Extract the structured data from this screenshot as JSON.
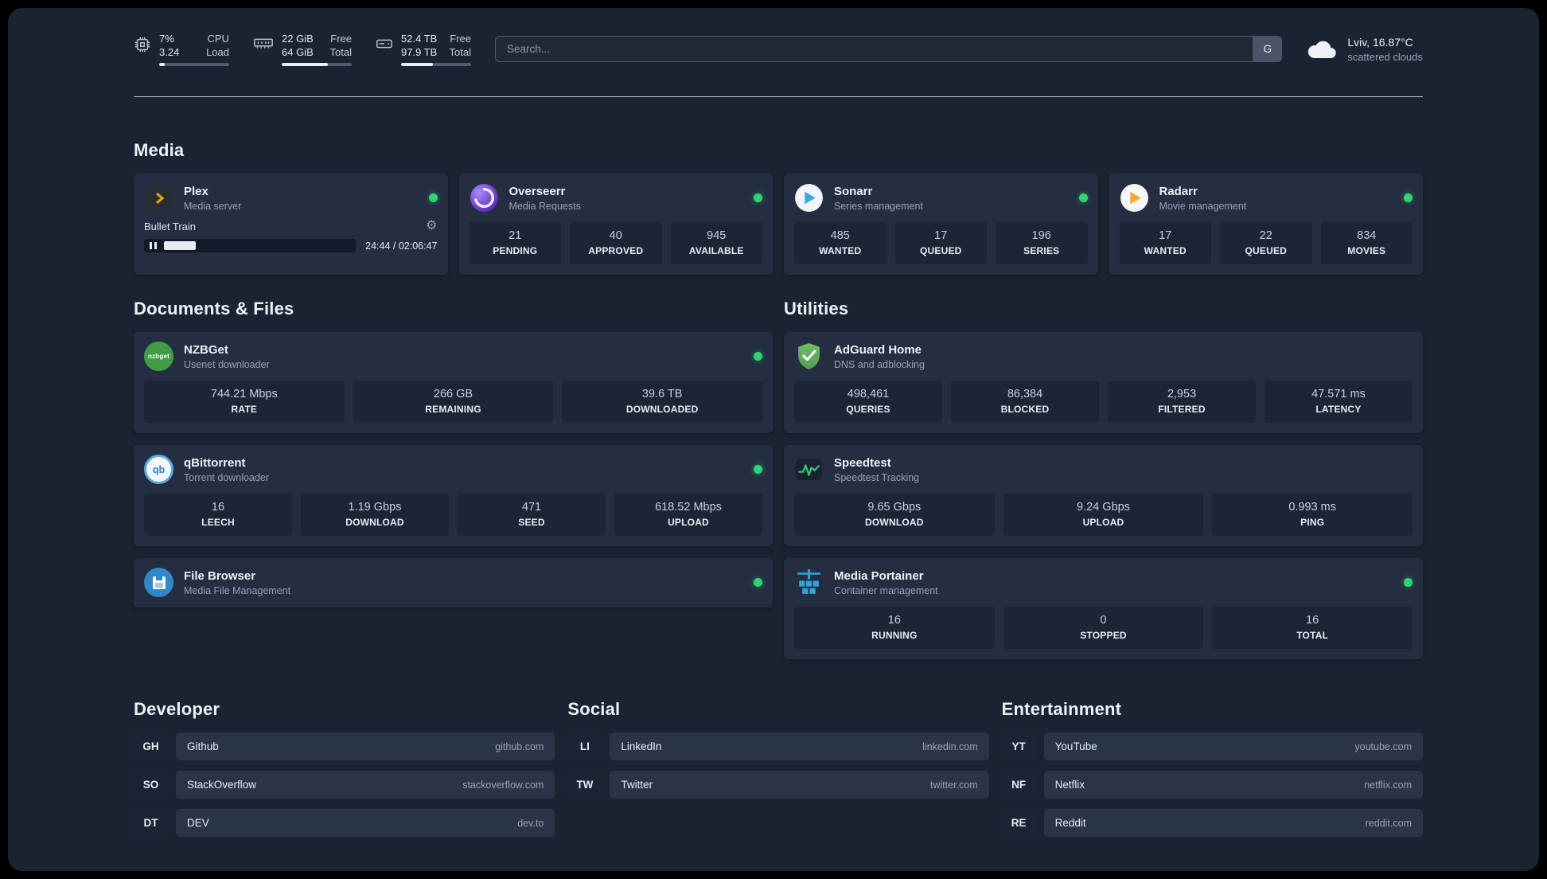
{
  "colors": {
    "background": "#1a2332",
    "card": "#242e40",
    "stat_tile": "#1b2536",
    "status_online_green": "#2ed573",
    "plex_accent": "#e5a00d"
  },
  "icons": {
    "settings_gear": "⚙"
  },
  "topbar": {
    "cpu": {
      "value_top": "7%",
      "label_top": "CPU",
      "value_bottom": "3.24",
      "label_bottom": "Load",
      "usage_percent": 8
    },
    "memory": {
      "value_top": "22 GiB",
      "label_top": "Free",
      "value_bottom": "64 GiB",
      "label_bottom": "Total",
      "usage_percent": 66
    },
    "disk": {
      "value_top": "52.4 TB",
      "label_top": "Free",
      "value_bottom": "97.9 TB",
      "label_bottom": "Total",
      "usage_percent": 46
    },
    "search": {
      "placeholder": "Search...",
      "provider_button": "G"
    },
    "weather": {
      "location": "Lviv, 16.87°C",
      "condition": "scattered clouds"
    }
  },
  "sections": {
    "media": {
      "title": "Media",
      "plex": {
        "name": "Plex",
        "description": "Media server",
        "status": "online",
        "now_playing": "Bullet Train",
        "progress_time": "24:44 / 02:06:47",
        "progress_percent": 15
      },
      "overseerr": {
        "name": "Overseerr",
        "description": "Media Requests",
        "status": "online",
        "stats": [
          {
            "value": "21",
            "label": "PENDING"
          },
          {
            "value": "40",
            "label": "APPROVED"
          },
          {
            "value": "945",
            "label": "AVAILABLE"
          }
        ]
      },
      "sonarr": {
        "name": "Sonarr",
        "description": "Series management",
        "status": "online",
        "stats": [
          {
            "value": "485",
            "label": "WANTED"
          },
          {
            "value": "17",
            "label": "QUEUED"
          },
          {
            "value": "196",
            "label": "SERIES"
          }
        ]
      },
      "radarr": {
        "name": "Radarr",
        "description": "Movie management",
        "status": "online",
        "stats": [
          {
            "value": "17",
            "label": "WANTED"
          },
          {
            "value": "22",
            "label": "QUEUED"
          },
          {
            "value": "834",
            "label": "MOVIES"
          }
        ]
      }
    },
    "files": {
      "title": "Documents & Files",
      "nzbget": {
        "name": "NZBGet",
        "description": "Usenet downloader",
        "status": "online",
        "icon_text": "nzbget",
        "stats": [
          {
            "value": "744.21 Mbps",
            "label": "RATE"
          },
          {
            "value": "266 GB",
            "label": "REMAINING"
          },
          {
            "value": "39.6 TB",
            "label": "DOWNLOADED"
          }
        ]
      },
      "qbittorrent": {
        "name": "qBittorrent",
        "description": "Torrent downloader",
        "status": "online",
        "icon_text": "qb",
        "stats": [
          {
            "value": "16",
            "label": "LEECH"
          },
          {
            "value": "1.19 Gbps",
            "label": "DOWNLOAD"
          },
          {
            "value": "471",
            "label": "SEED"
          },
          {
            "value": "618.52 Mbps",
            "label": "UPLOAD"
          }
        ]
      },
      "filebrowser": {
        "name": "File Browser",
        "description": "Media File Management",
        "status": "online"
      }
    },
    "utilities": {
      "title": "Utilities",
      "adguard": {
        "name": "AdGuard Home",
        "description": "DNS and adblocking",
        "stats": [
          {
            "value": "498,461",
            "label": "QUERIES"
          },
          {
            "value": "86,384",
            "label": "BLOCKED"
          },
          {
            "value": "2,953",
            "label": "FILTERED"
          },
          {
            "value": "47.571 ms",
            "label": "LATENCY"
          }
        ]
      },
      "speedtest": {
        "name": "Speedtest",
        "description": "Speedtest Tracking",
        "stats": [
          {
            "value": "9.65 Gbps",
            "label": "DOWNLOAD"
          },
          {
            "value": "9.24 Gbps",
            "label": "UPLOAD"
          },
          {
            "value": "0.993 ms",
            "label": "PING"
          }
        ]
      },
      "portainer": {
        "name": "Media Portainer",
        "description": "Container management",
        "status": "online",
        "stats": [
          {
            "value": "16",
            "label": "RUNNING"
          },
          {
            "value": "0",
            "label": "STOPPED"
          },
          {
            "value": "16",
            "label": "TOTAL"
          }
        ]
      }
    },
    "developer": {
      "title": "Developer",
      "links": [
        {
          "abbr": "GH",
          "name": "Github",
          "url": "github.com"
        },
        {
          "abbr": "SO",
          "name": "StackOverflow",
          "url": "stackoverflow.com"
        },
        {
          "abbr": "DT",
          "name": "DEV",
          "url": "dev.to"
        }
      ]
    },
    "social": {
      "title": "Social",
      "links": [
        {
          "abbr": "LI",
          "name": "LinkedIn",
          "url": "linkedin.com"
        },
        {
          "abbr": "TW",
          "name": "Twitter",
          "url": "twitter.com"
        }
      ]
    },
    "entertainment": {
      "title": "Entertainment",
      "links": [
        {
          "abbr": "YT",
          "name": "YouTube",
          "url": "youtube.com"
        },
        {
          "abbr": "NF",
          "name": "Netflix",
          "url": "netflix.com"
        },
        {
          "abbr": "RE",
          "name": "Reddit",
          "url": "reddit.com"
        }
      ]
    }
  }
}
